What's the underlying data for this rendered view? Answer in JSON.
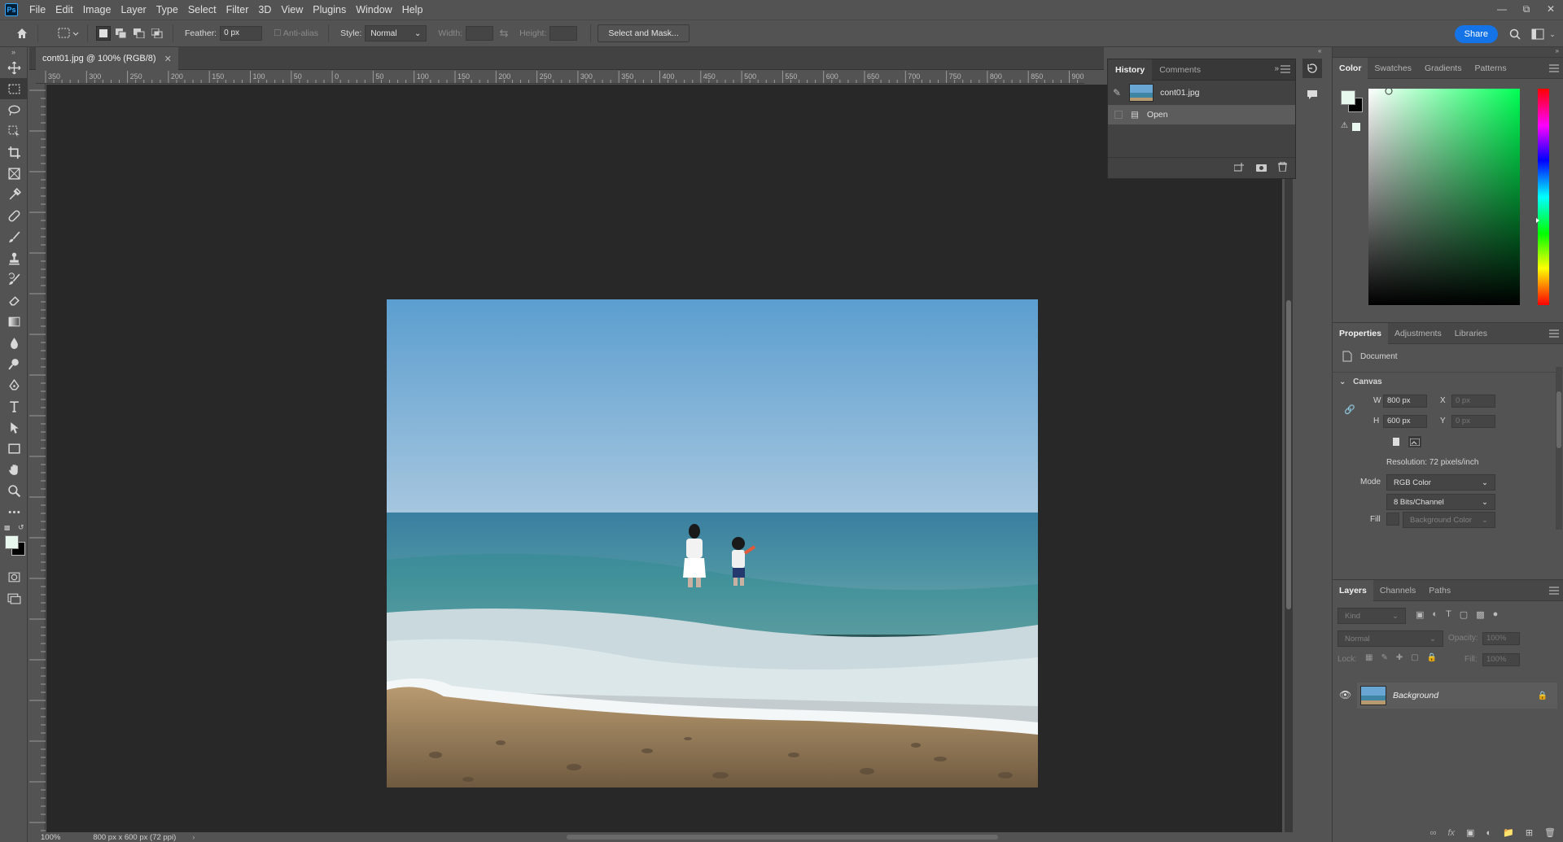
{
  "app": {
    "logo": "Ps",
    "menu": [
      "File",
      "Edit",
      "Image",
      "Layer",
      "Type",
      "Select",
      "Filter",
      "3D",
      "View",
      "Plugins",
      "Window",
      "Help"
    ]
  },
  "options": {
    "feather_label": "Feather:",
    "feather_value": "0 px",
    "antialias_label": "Anti-alias",
    "style_label": "Style:",
    "style_value": "Normal",
    "width_label": "Width:",
    "height_label": "Height:",
    "select_mask_label": "Select and Mask...",
    "share_label": "Share"
  },
  "document": {
    "tab_title": "cont01.jpg @ 100% (RGB/8)",
    "ruler_ticks": [
      "350",
      "300",
      "250",
      "200",
      "150",
      "100",
      "50",
      "0",
      "50",
      "100",
      "150",
      "200",
      "250",
      "300",
      "350",
      "400",
      "450",
      "500",
      "550",
      "600",
      "650",
      "700",
      "750",
      "800",
      "850",
      "900"
    ],
    "zoom": "100%",
    "status": "800 px x 600 px (72 ppi)"
  },
  "history": {
    "tabs": [
      "History",
      "Comments"
    ],
    "snapshot_name": "cont01.jpg",
    "step": "Open"
  },
  "color_panel": {
    "tabs": [
      "Color",
      "Swatches",
      "Gradients",
      "Patterns"
    ],
    "foreground": "#e8f8ee",
    "background": "#000000",
    "hue_color": "#00ff55"
  },
  "properties": {
    "tabs": [
      "Properties",
      "Adjustments",
      "Libraries"
    ],
    "doc_label": "Document",
    "canvas_section": "Canvas",
    "w_label": "W",
    "w_value": "800 px",
    "h_label": "H",
    "h_value": "600 px",
    "x_label": "X",
    "x_placeholder": "0 px",
    "y_label": "Y",
    "y_placeholder": "0 px",
    "resolution": "Resolution: 72 pixels/inch",
    "mode_label": "Mode",
    "mode_value": "RGB Color",
    "depth_value": "8 Bits/Channel",
    "fill_label": "Fill",
    "fill_value": "Background Color"
  },
  "layers": {
    "tabs": [
      "Layers",
      "Channels",
      "Paths"
    ],
    "kind_placeholder": "Kind",
    "blend_mode": "Normal",
    "opacity_label": "Opacity:",
    "opacity_value": "100%",
    "lock_label": "Lock:",
    "fill_label": "Fill:",
    "fill_value": "100%",
    "layer_name": "Background"
  }
}
